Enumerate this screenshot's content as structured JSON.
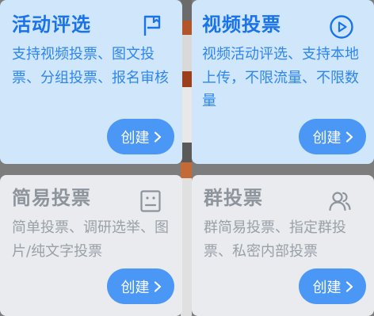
{
  "cards": [
    {
      "title": "活动评选",
      "description": "支持视频投票、图文投票、分组投票、报名审核",
      "button_label": "创建",
      "icon": "flag-icon",
      "state": "active"
    },
    {
      "title": "视频投票",
      "description": "视频活动评选、支持本地上传，不限流量、不限数量",
      "button_label": "创建",
      "icon": "play-circle-icon",
      "state": "active"
    },
    {
      "title": "简易投票",
      "description": "简单投票、调研选举、图片/纯文字投票",
      "button_label": "创建",
      "icon": "form-icon",
      "state": "inactive"
    },
    {
      "title": "群投票",
      "description": "群简易投票、指定群投票、私密内部投票",
      "button_label": "创建",
      "icon": "users-icon",
      "state": "inactive"
    }
  ],
  "colors": {
    "active_card_bg": "#cfe6fb",
    "inactive_card_bg": "#e9ebee",
    "active_title": "#1a73e8",
    "inactive_title": "#8e949c",
    "button_bg": "#4a97f6"
  }
}
